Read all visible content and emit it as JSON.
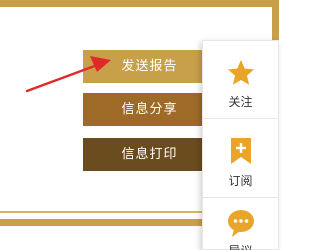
{
  "actions": {
    "send_report": "发送报告",
    "share_info": "信息分享",
    "print_info": "信息打印"
  },
  "toolbar": {
    "follow_label": "关注",
    "subscribe_label": "订阅",
    "guide_label": "导议"
  },
  "icons": {
    "follow": "star-icon",
    "subscribe": "bookmark-plus-icon",
    "guide": "chat-bubble-icon",
    "pointer": "red-arrow"
  },
  "colors": {
    "frame": "#c9a04a",
    "report_button": "#c9a04a",
    "share_button": "#9e6a27",
    "print_button": "#6b4c1e",
    "icon": "#e8a52a",
    "arrow": "#e02a2a"
  }
}
